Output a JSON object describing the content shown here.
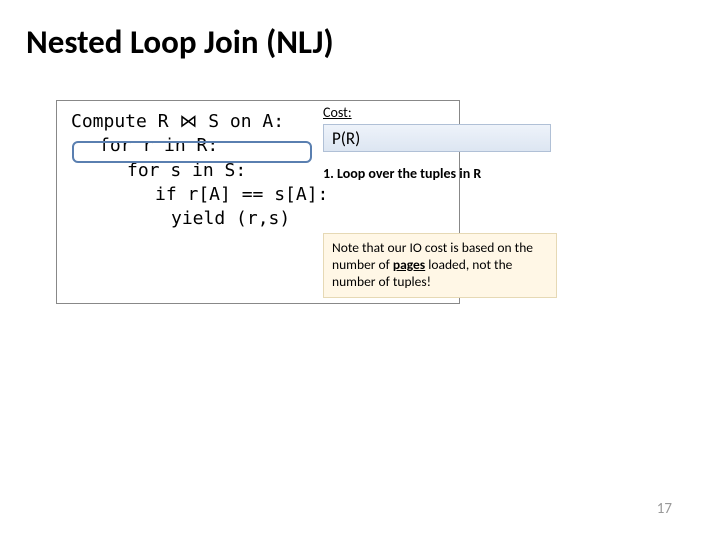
{
  "title": "Nested Loop Join (NLJ)",
  "code": {
    "l1a": "Compute R ",
    "l1b": " S on A:",
    "l2": "for r in R:",
    "l3": "for s in S:",
    "l4": "if r[A] == s[A]:",
    "l5": "yield (r,s)"
  },
  "bowtie": "⋈",
  "cost": {
    "label": "Cost:",
    "value": "P(R)"
  },
  "step": "1.  Loop over the tuples in R",
  "note": {
    "t1": "Note that our IO cost is based on the number of ",
    "pages": "pages",
    "t2": " loaded, not the number of tuples!"
  },
  "pagenum": "17"
}
